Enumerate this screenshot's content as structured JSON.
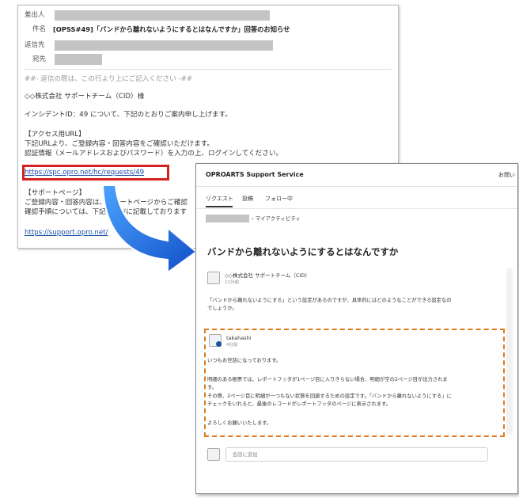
{
  "email": {
    "header": {
      "from_label": "差出人",
      "subject_label": "件名",
      "subject_value": "[OPSS#49]「バンドから離れないようにするとはなんですか」回答のお知らせ",
      "reply_to_label": "返信先",
      "to_label": "宛先"
    },
    "body": {
      "reply_marker": "##- 返信の際は、この行より上にご記入ください -##",
      "addressee": "◇◇株式会社 サポートチーム（CID）様",
      "intro": "インシデントID：49 について、下記のとおりご案内申し上げます。",
      "access_heading": "【アクセス用URL】",
      "access_line1": "下記URLより、ご登録内容・回答内容をご確認いただけます。",
      "access_line2": "認証情報（メールアドレスおよびパスワード）を入力の上、ログインしてください。",
      "access_url": "https://spc.opro.net/hc/requests/49",
      "support_heading": "【サポートページ】",
      "support_line1": "ご登録内容・回答内容は、サポートページからご確認",
      "support_line2": "確認手順については、下記ページに記載しております",
      "support_url": "https://support.opro.net/"
    }
  },
  "support_site": {
    "brand": "OPROARTS Support Service",
    "header_right": "お問い",
    "tabs": [
      "リクエスト",
      "投稿",
      "フォロー中"
    ],
    "breadcrumb_tail": "› マイアクティビティ",
    "request_title": "バンドから離れないようにするとはなんですか",
    "question": {
      "author": "◇◇株式会社 サポートチーム（CID）",
      "time": "11分前",
      "text_line1": "「バンドから離れないようにする」という設定があるのですが、具体的にはどのようなことができる設定なの",
      "text_line2": "でしょうか。"
    },
    "answer": {
      "author": "takahashi",
      "time": "4分前",
      "greeting": "いつもお世話になっております。",
      "line1": "明細のある帳票では、レポートフッタが1ページ目に入りきらない場合、明細が空の2ページ目が出力されま",
      "line1b": "す。",
      "line2": "その際、2ページ目に明細が一つもない状態を回避するための設定です。「バンドから離れないようにする」に",
      "line3": "チェックをいれると、最後のレコードがレポートフッタのページに表示されます。",
      "closing": "よろしくお願いいたします。"
    },
    "comment_placeholder": "会話に追加"
  },
  "colors": {
    "highlight_box": "#d61f1f",
    "dashed_box": "#e07a18",
    "arrow": "#1e5fd6",
    "link": "#1a4fa8"
  }
}
